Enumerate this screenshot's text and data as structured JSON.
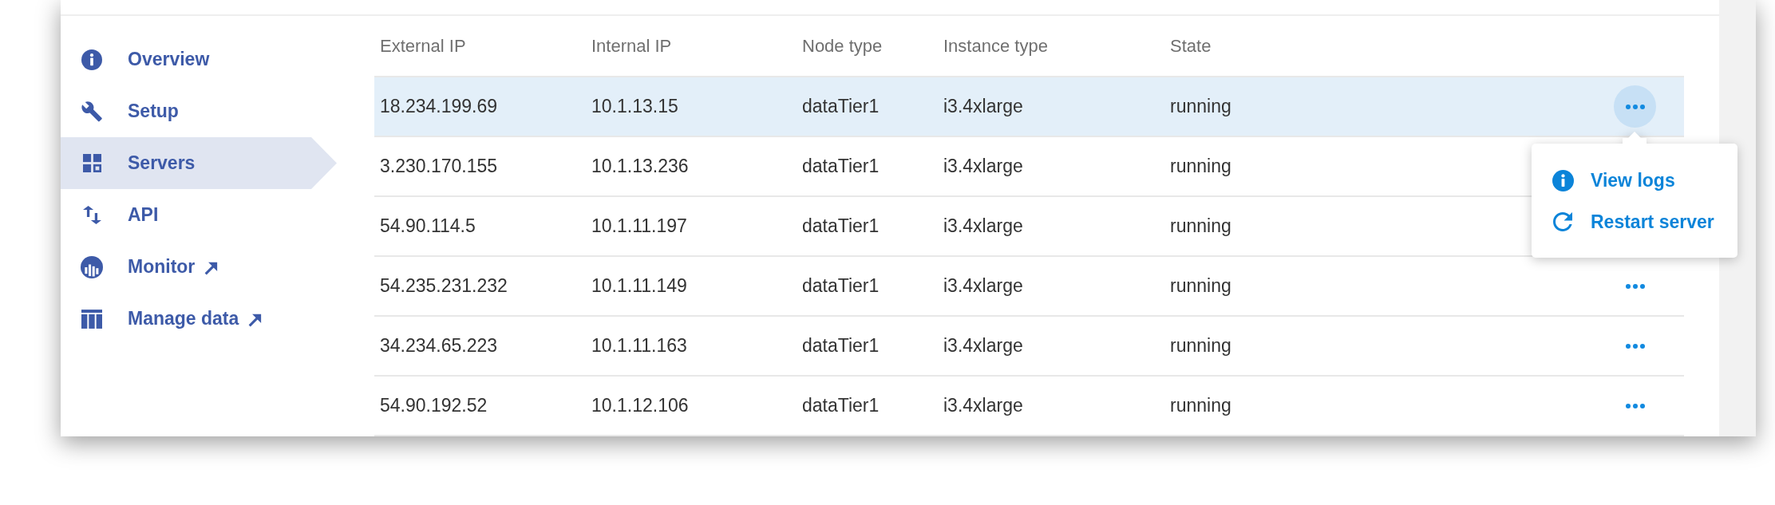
{
  "sidebar": {
    "items": [
      {
        "label": "Overview",
        "selected": false,
        "external": false
      },
      {
        "label": "Setup",
        "selected": false,
        "external": false
      },
      {
        "label": "Servers",
        "selected": true,
        "external": false
      },
      {
        "label": "API",
        "selected": false,
        "external": false
      },
      {
        "label": "Monitor",
        "selected": false,
        "external": true
      },
      {
        "label": "Manage data",
        "selected": false,
        "external": true
      }
    ]
  },
  "table": {
    "columns": [
      "External IP",
      "Internal IP",
      "Node type",
      "Instance type",
      "State"
    ],
    "rows": [
      {
        "cells": [
          "18.234.199.69",
          "10.1.13.15",
          "dataTier1",
          "i3.4xlarge",
          "running"
        ],
        "selected": true,
        "menu_open": true
      },
      {
        "cells": [
          "3.230.170.155",
          "10.1.13.236",
          "dataTier1",
          "i3.4xlarge",
          "running"
        ],
        "selected": false,
        "menu_open": false
      },
      {
        "cells": [
          "54.90.114.5",
          "10.1.11.197",
          "dataTier1",
          "i3.4xlarge",
          "running"
        ],
        "selected": false,
        "menu_open": false
      },
      {
        "cells": [
          "54.235.231.232",
          "10.1.11.149",
          "dataTier1",
          "i3.4xlarge",
          "running"
        ],
        "selected": false,
        "menu_open": false
      },
      {
        "cells": [
          "34.234.65.223",
          "10.1.11.163",
          "dataTier1",
          "i3.4xlarge",
          "running"
        ],
        "selected": false,
        "menu_open": false
      },
      {
        "cells": [
          "54.90.192.52",
          "10.1.12.106",
          "dataTier1",
          "i3.4xlarge",
          "running"
        ],
        "selected": false,
        "menu_open": false
      }
    ],
    "row_menu": {
      "items": [
        "View logs",
        "Restart server"
      ]
    }
  }
}
